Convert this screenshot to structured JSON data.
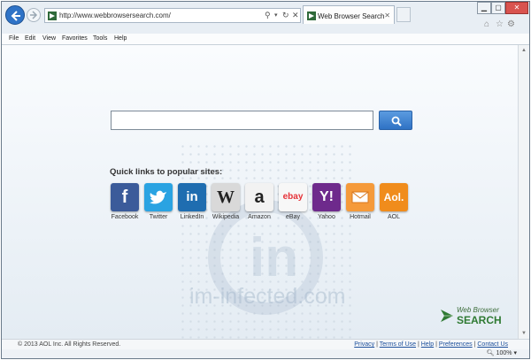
{
  "address_bar": {
    "url": "http://www.webbrowsersearch.com/"
  },
  "tab": {
    "title": "Web Browser Search"
  },
  "menu": [
    "File",
    "Edit",
    "View",
    "Favorites",
    "Tools",
    "Help"
  ],
  "search": {
    "value": "",
    "placeholder": ""
  },
  "quick_links": {
    "title": "Quick links to popular sites:",
    "items": [
      {
        "label": "Facebook",
        "glyph": "f",
        "color": "#3b5b9a",
        "icon": "facebook-icon"
      },
      {
        "label": "Twitter",
        "glyph": "",
        "color": "#2aa3e2",
        "icon": "twitter-icon"
      },
      {
        "label": "LinkedIn",
        "glyph": "in",
        "color": "#1f6db0",
        "icon": "linkedin-icon"
      },
      {
        "label": "Wikipedia",
        "glyph": "W",
        "color": "#d9d9d9",
        "icon": "wikipedia-icon"
      },
      {
        "label": "Amazon",
        "glyph": "a",
        "color": "#f2f2f2",
        "icon": "amazon-icon"
      },
      {
        "label": "eBay",
        "glyph": "ebay",
        "color": "#f7f7f7",
        "icon": "ebay-icon"
      },
      {
        "label": "Yahoo",
        "glyph": "Y!",
        "color": "#6e2a8c",
        "icon": "yahoo-icon"
      },
      {
        "label": "Hotmail",
        "glyph": "",
        "color": "#f59a3a",
        "icon": "hotmail-icon"
      },
      {
        "label": "AOL",
        "glyph": "Aol.",
        "color": "#f08c1c",
        "icon": "aol-icon"
      }
    ]
  },
  "watermark": {
    "text": "im-infected.com",
    "glyph": "in"
  },
  "brand": {
    "line1": "Web Browser",
    "line2": "SEARCH"
  },
  "footer": {
    "copyright": "© 2013 AOL Inc. All Rights Reserved.",
    "links": [
      "Privacy",
      "Terms of Use",
      "Help",
      "Preferences",
      "Contact Us"
    ],
    "separator": "|"
  },
  "status": {
    "zoom": "100%"
  }
}
